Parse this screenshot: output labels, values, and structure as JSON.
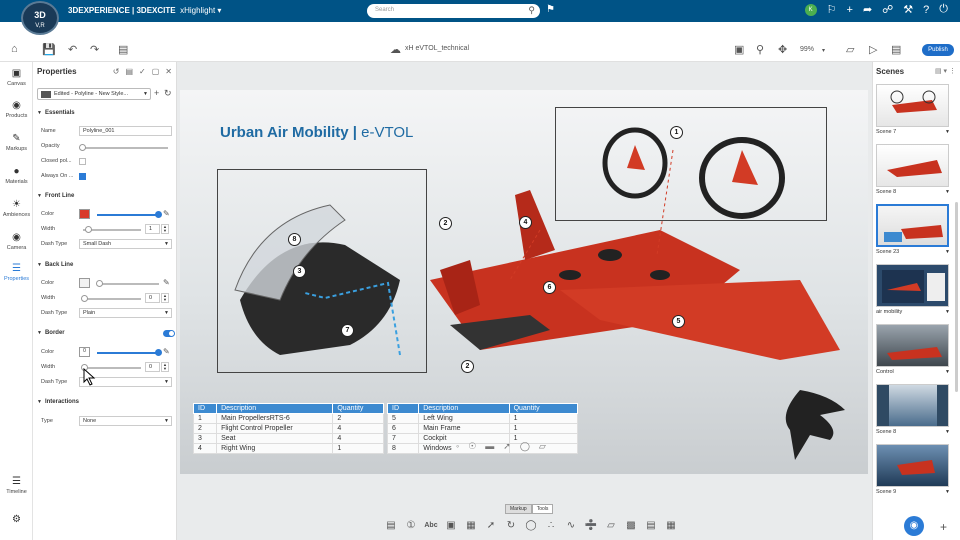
{
  "app": {
    "compass_main": "3D",
    "compass_version": "V,R",
    "brand_bold": "3DEXPERIENCE | 3DEXCITE",
    "brand_app": "xHighlight",
    "search_placeholder": "Search",
    "avatar_initial": "K"
  },
  "toolbar": {
    "doc_title": "xH eVTOL_technical",
    "zoom": "99%",
    "publish": "Publish"
  },
  "leftnav": {
    "items": [
      {
        "label": "Canvas",
        "icon": "canvas-icon"
      },
      {
        "label": "Products",
        "icon": "products-icon"
      },
      {
        "label": "Markups",
        "icon": "markups-icon"
      },
      {
        "label": "Materials",
        "icon": "materials-icon"
      },
      {
        "label": "Ambiences",
        "icon": "ambiences-icon"
      },
      {
        "label": "Camera",
        "icon": "camera-icon"
      },
      {
        "label": "Properties",
        "icon": "properties-icon"
      }
    ],
    "timeline": "Timeline"
  },
  "properties": {
    "title": "Properties",
    "style": "Edited - Polyline - New Style...",
    "essentials": {
      "title": "Essentials",
      "name_label": "Name",
      "name_value": "Polyline_001",
      "opacity_label": "Opacity",
      "opacity": 0.0,
      "closed_label": "Closed pol...",
      "closed": false,
      "always_on_label": "Always On ...",
      "always_on": true
    },
    "front_line": {
      "title": "Front Line",
      "color_label": "Color",
      "color": "#d83a2a",
      "width_label": "Width",
      "width": "1",
      "dash_label": "Dash Type",
      "dash": "Small Dash"
    },
    "back_line": {
      "title": "Back Line",
      "color_label": "Color",
      "color": "#f2f2f2",
      "width_label": "Width",
      "width": "0",
      "dash_label": "Dash Type",
      "dash": "Plain"
    },
    "border": {
      "title": "Border",
      "enabled": true,
      "color_label": "Color",
      "color_value": "0",
      "width_label": "Width",
      "width": "0",
      "dash_label": "Dash Type",
      "dash": ""
    },
    "interactions": {
      "title": "Interactions",
      "type_label": "Type",
      "type": "None"
    }
  },
  "canvas": {
    "title_main": "Urban Air Mobility |",
    "title_sub": "e-VTOL",
    "callouts": [
      "1",
      "2",
      "3",
      "4",
      "5",
      "6",
      "7",
      "8",
      "2"
    ],
    "table_left": {
      "headers": [
        "ID",
        "Description",
        "Quantity"
      ],
      "rows": [
        [
          "1",
          "Main PropellersRTS-6",
          "2"
        ],
        [
          "2",
          "Flight Control Propeller",
          "4"
        ],
        [
          "3",
          "Seat",
          "4"
        ],
        [
          "4",
          "Right Wing",
          "1"
        ]
      ]
    },
    "table_right": {
      "headers": [
        "ID",
        "Description",
        "Quantity"
      ],
      "rows": [
        [
          "5",
          "Left Wing",
          "1"
        ],
        [
          "6",
          "Main Frame",
          "1"
        ],
        [
          "7",
          "Cockpit",
          "1"
        ],
        [
          "8",
          "Windows",
          ""
        ]
      ]
    }
  },
  "markup": {
    "tabs": [
      "Markup",
      "Tools"
    ],
    "text_tool": "Abc"
  },
  "scenes": {
    "title": "Scenes",
    "items": [
      "Scene 7",
      "Scene 8",
      "Scene 23",
      "air mobility",
      "Control",
      "Scene 8",
      "Scene 9"
    ]
  }
}
